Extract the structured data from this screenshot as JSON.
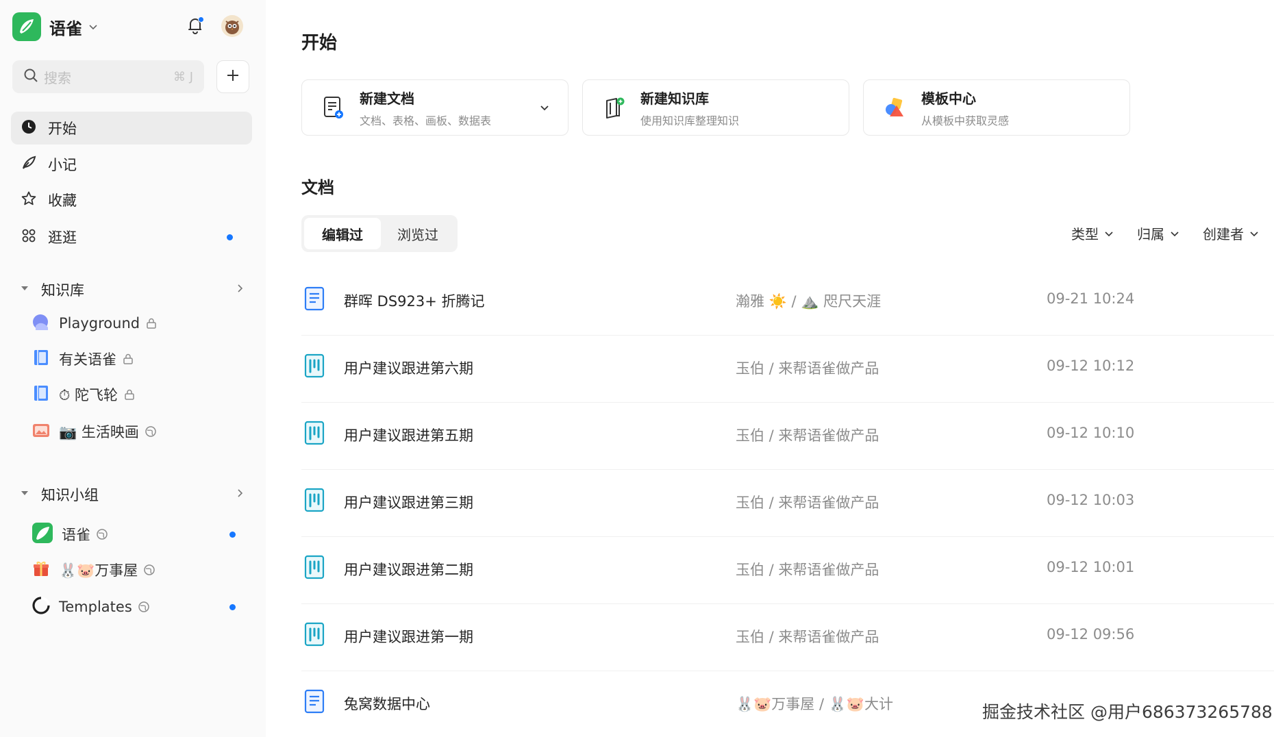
{
  "app": {
    "name": "语雀"
  },
  "search": {
    "placeholder": "搜索",
    "shortcut": "⌘ J"
  },
  "nav": [
    {
      "label": "开始",
      "active": true,
      "dot": false
    },
    {
      "label": "小记",
      "active": false,
      "dot": false
    },
    {
      "label": "收藏",
      "active": false,
      "dot": false
    },
    {
      "label": "逛逛",
      "active": false,
      "dot": true
    }
  ],
  "libraries": {
    "label": "知识库",
    "items": [
      {
        "label": "Playground",
        "badge": "lock"
      },
      {
        "label": "有关语雀",
        "badge": "lock"
      },
      {
        "label": "⏱ 陀飞轮",
        "badge": "lock"
      },
      {
        "label": "📷 生活映画",
        "badge": "public"
      }
    ]
  },
  "groups": {
    "label": "知识小组",
    "items": [
      {
        "label": "语雀",
        "badge": "public",
        "dot": true
      },
      {
        "label": "🐰🐷万事屋",
        "badge": "public",
        "dot": false
      },
      {
        "label": "Templates",
        "badge": "public",
        "dot": true
      }
    ]
  },
  "main": {
    "title": "开始",
    "cards": [
      {
        "title": "新建文档",
        "subtitle": "文档、表格、画板、数据表",
        "icon": "new-doc-icon"
      },
      {
        "title": "新建知识库",
        "subtitle": "使用知识库整理知识",
        "icon": "new-library-icon"
      },
      {
        "title": "模板中心",
        "subtitle": "从模板中获取灵感",
        "icon": "template-icon"
      }
    ],
    "docs_title": "文档",
    "tabs": [
      "编辑过",
      "浏览过"
    ],
    "filters": [
      "类型",
      "归属",
      "创建者"
    ],
    "rows": [
      {
        "title": "群晖 DS923+ 折腾记",
        "owner": "瀚雅 ☀️ / ⛰️ 咫尺天涯",
        "time": "09-21 10:24",
        "icon": "doc"
      },
      {
        "title": "用户建议跟进第六期",
        "owner": "玉伯 / 来帮语雀做产品",
        "time": "09-12 10:12",
        "icon": "board"
      },
      {
        "title": "用户建议跟进第五期",
        "owner": "玉伯 / 来帮语雀做产品",
        "time": "09-12 10:10",
        "icon": "board"
      },
      {
        "title": "用户建议跟进第三期",
        "owner": "玉伯 / 来帮语雀做产品",
        "time": "09-12 10:03",
        "icon": "board"
      },
      {
        "title": "用户建议跟进第二期",
        "owner": "玉伯 / 来帮语雀做产品",
        "time": "09-12 10:01",
        "icon": "board"
      },
      {
        "title": "用户建议跟进第一期",
        "owner": "玉伯 / 来帮语雀做产品",
        "time": "09-12 09:56",
        "icon": "board"
      },
      {
        "title": "兔窝数据中心",
        "owner": "🐰🐷万事屋 / 🐰🐷大计",
        "time": "",
        "icon": "doc"
      }
    ]
  },
  "watermark": "掘金技术社区 @用户686373265788",
  "colors": {
    "brand": "#2eb85c",
    "accent": "#1677ff",
    "doc_icon": "#2d7df6",
    "board_icon": "#1aa5c5"
  }
}
